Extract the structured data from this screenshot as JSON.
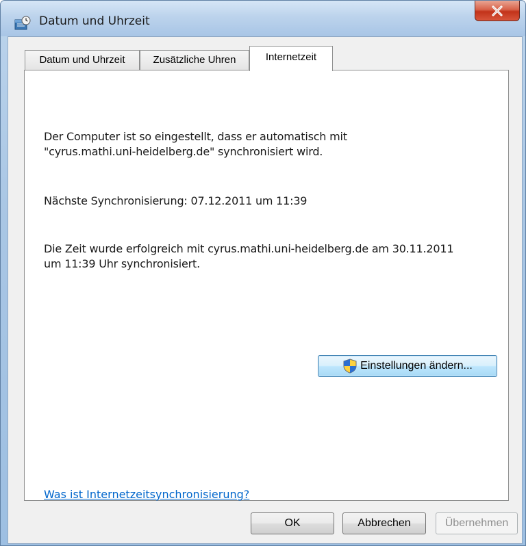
{
  "window": {
    "title": "Datum und Uhrzeit"
  },
  "tabs": [
    {
      "label": "Datum und Uhrzeit"
    },
    {
      "label": "Zusätzliche Uhren"
    },
    {
      "label": "Internetzeit",
      "active": true
    }
  ],
  "panel": {
    "sync_line1": "Der Computer ist so eingestellt, dass er automatisch mit",
    "sync_line2": "\"cyrus.mathi.uni-heidelberg.de\" synchronisiert wird.",
    "next_sync": "Nächste Synchronisierung: 07.12.2011 um 11:39",
    "result_line1": "Die Zeit wurde erfolgreich mit cyrus.mathi.uni-heidelberg.de am 30.11.2011",
    "result_line2": "um 11:39 Uhr synchronisiert.",
    "change_settings_label": "Einstellungen ändern...",
    "help_link": "Was ist Internetzeitsynchronisierung?"
  },
  "footer": {
    "ok_label": "OK",
    "cancel_label": "Abbrechen",
    "apply_label": "Übernehmen"
  },
  "colors": {
    "link": "#0066cc",
    "close_button": "#c2331a",
    "focus_border": "#3c7fb1"
  },
  "icons": [
    "clock-calendar-icon",
    "close-icon",
    "uac-shield-icon"
  ]
}
